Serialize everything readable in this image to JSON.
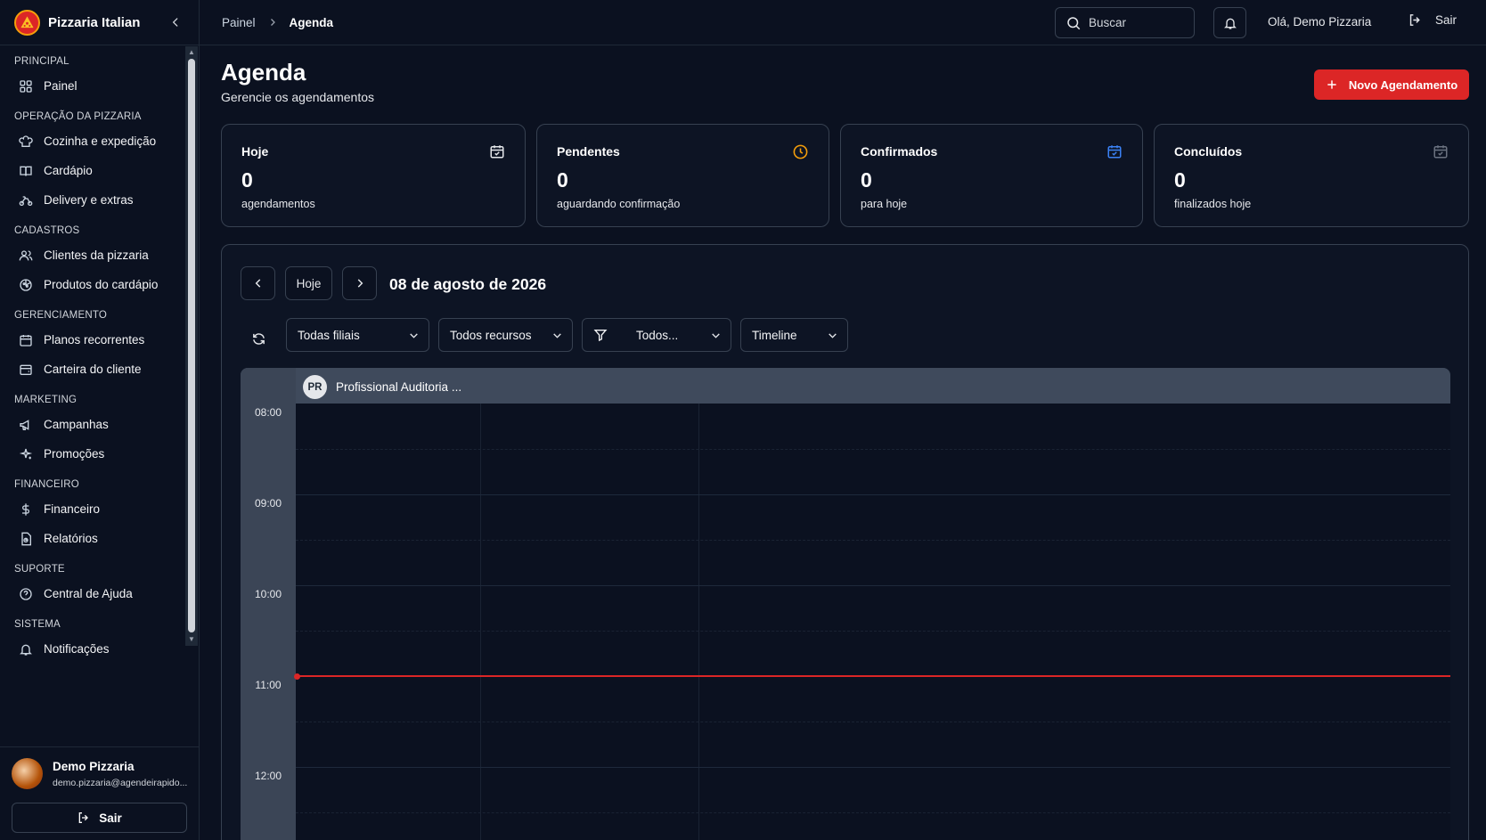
{
  "brand": {
    "name": "Pizzaria Italian"
  },
  "sidebar": {
    "sections": [
      {
        "title": "PRINCIPAL",
        "items": [
          {
            "label": "Painel",
            "icon": "grid-icon"
          }
        ]
      },
      {
        "title": "OPERAÇÃO DA PIZZARIA",
        "items": [
          {
            "label": "Cozinha e expedição",
            "icon": "chef-hat-icon"
          },
          {
            "label": "Cardápio",
            "icon": "book-icon"
          },
          {
            "label": "Delivery e extras",
            "icon": "bike-icon"
          }
        ]
      },
      {
        "title": "CADASTROS",
        "items": [
          {
            "label": "Clientes da pizzaria",
            "icon": "users-icon"
          },
          {
            "label": "Produtos do cardápio",
            "icon": "pizza-icon"
          }
        ]
      },
      {
        "title": "GERENCIAMENTO",
        "items": [
          {
            "label": "Planos recorrentes",
            "icon": "calendar-icon"
          },
          {
            "label": "Carteira do cliente",
            "icon": "wallet-icon"
          }
        ]
      },
      {
        "title": "MARKETING",
        "items": [
          {
            "label": "Campanhas",
            "icon": "megaphone-icon"
          },
          {
            "label": "Promoções",
            "icon": "sparkles-icon"
          }
        ]
      },
      {
        "title": "FINANCEIRO",
        "items": [
          {
            "label": "Financeiro",
            "icon": "dollar-icon"
          },
          {
            "label": "Relatórios",
            "icon": "report-icon"
          }
        ]
      },
      {
        "title": "SUPORTE",
        "items": [
          {
            "label": "Central de Ajuda",
            "icon": "help-icon"
          }
        ]
      },
      {
        "title": "SISTEMA",
        "items": [
          {
            "label": "Notificações",
            "icon": "bell-icon"
          }
        ]
      }
    ],
    "user": {
      "name": "Demo Pizzaria",
      "email": "demo.pizzaria@agendeirapido..."
    },
    "logout_label": "Sair"
  },
  "topbar": {
    "breadcrumb": {
      "parent": "Painel",
      "current": "Agenda"
    },
    "search_placeholder": "Buscar",
    "greeting": "Olá, Demo Pizzaria",
    "logout_label": "Sair"
  },
  "page": {
    "title": "Agenda",
    "subtitle": "Gerencie os agendamentos",
    "new_button": "Novo Agendamento"
  },
  "stats": [
    {
      "title": "Hoje",
      "value": "0",
      "sub": "agendamentos",
      "icon": "calendar-check-icon",
      "color": "#e5e7eb"
    },
    {
      "title": "Pendentes",
      "value": "0",
      "sub": "aguardando confirmação",
      "icon": "clock-icon",
      "color": "#f59e0b"
    },
    {
      "title": "Confirmados",
      "value": "0",
      "sub": "para hoje",
      "icon": "calendar-check-icon",
      "color": "#3b82f6"
    },
    {
      "title": "Concluídos",
      "value": "0",
      "sub": "finalizados hoje",
      "icon": "calendar-check-icon",
      "color": "#6b7280"
    }
  ],
  "calendar": {
    "today_label": "Hoje",
    "date": "08 de agosto de 2026",
    "filters": {
      "branch": "Todas filiais",
      "resources": "Todos recursos",
      "status": "Todos...",
      "view": "Timeline"
    },
    "resource": {
      "initials": "PR",
      "name": "Profissional Auditoria ..."
    },
    "hours": [
      "08:00",
      "09:00",
      "10:00",
      "11:00",
      "12:00"
    ],
    "now_hour": 11.0
  },
  "colors": {
    "accent": "#dc2626",
    "background": "#0b1120",
    "border": "#374151"
  }
}
